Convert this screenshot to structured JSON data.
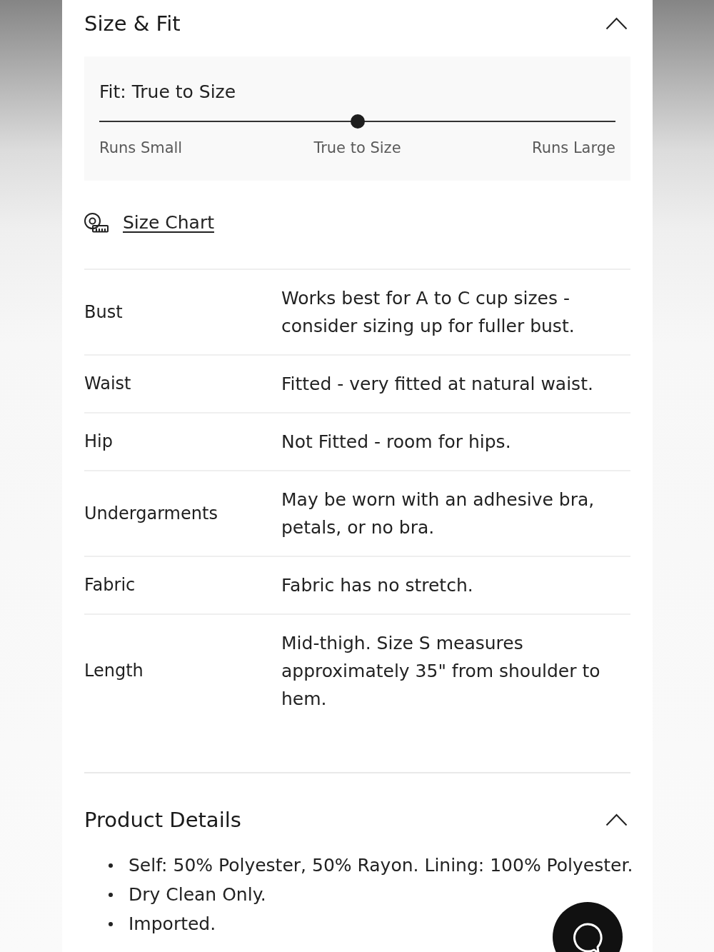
{
  "size_fit": {
    "title": "Size & Fit",
    "expanded": true,
    "fit": {
      "label": "Fit: True to Size",
      "level": 0.5,
      "scale": [
        "Runs Small",
        "True to Size",
        "Runs Large"
      ]
    },
    "size_chart_link": "Size Chart",
    "rows": [
      {
        "label": "Bust",
        "value": "Works best for A to C cup sizes - consider sizing up for fuller bust."
      },
      {
        "label": "Waist",
        "value": "Fitted - very fitted at natural waist."
      },
      {
        "label": "Hip",
        "value": "Not Fitted - room for hips."
      },
      {
        "label": "Undergarments",
        "value": "May be worn with an adhesive bra, petals, or no bra."
      },
      {
        "label": "Fabric",
        "value": "Fabric has no stretch."
      },
      {
        "label": "Length",
        "value": "Mid-thigh. Size S measures approximately 35\" from shoulder to hem."
      }
    ]
  },
  "product_details": {
    "title": "Product Details",
    "expanded": true,
    "bullets": [
      "Self: 50% Polyester, 50% Rayon. Lining: 100% Polyester.",
      "Dry Clean Only.",
      "Imported."
    ]
  }
}
